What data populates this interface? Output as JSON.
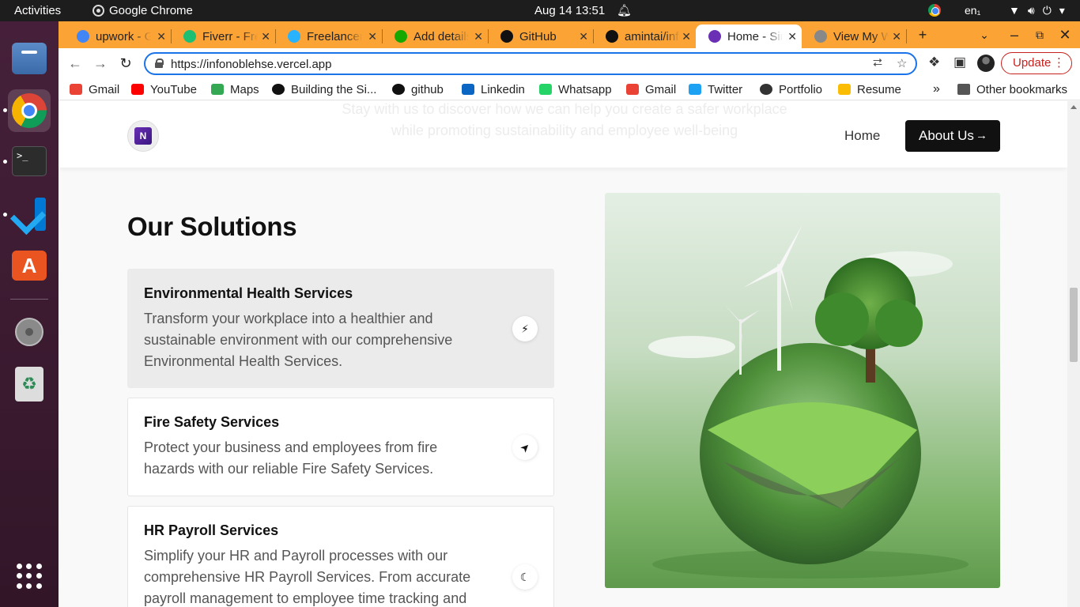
{
  "os": {
    "activities": "Activities",
    "app_name": "Google Chrome",
    "clock": "Aug 14  13:51",
    "language": "en₁",
    "dock": [
      "files-icon",
      "chrome-icon",
      "terminal-icon",
      "vscode-icon",
      "app-store-icon",
      "disc-icon",
      "trash-icon",
      "app-grid-icon"
    ]
  },
  "browser": {
    "tabs": [
      {
        "label": "upwork - Google",
        "icon": "google-icon",
        "color": "#4285f4"
      },
      {
        "label": "Fiverr - Freelance",
        "icon": "fiverr-icon",
        "color": "#1dbf73"
      },
      {
        "label": "Freelancer",
        "icon": "freelancer-icon",
        "color": "#29b2fe"
      },
      {
        "label": "Add details",
        "icon": "upwork-icon",
        "color": "#14a800"
      },
      {
        "label": "GitHub",
        "icon": "github-icon",
        "color": "#111111"
      },
      {
        "label": "amintai/infonoble",
        "icon": "github-icon",
        "color": "#111111"
      },
      {
        "label": "Home - Simple",
        "icon": "site-favicon",
        "color": "#6a2fb5",
        "active": true
      },
      {
        "label": "View My Work",
        "icon": "globe-icon",
        "color": "#888888"
      }
    ],
    "address": "https://infonoblehse.vercel.app",
    "update_label": "Update",
    "bookmarks": [
      {
        "label": "Gmail",
        "icon": "gmail-icon"
      },
      {
        "label": "YouTube",
        "icon": "youtube-icon"
      },
      {
        "label": "Maps",
        "icon": "maps-icon"
      },
      {
        "label": "Building the Si...",
        "icon": "vercel-icon"
      },
      {
        "label": "github",
        "icon": "github-icon"
      },
      {
        "label": "Linkedin",
        "icon": "linkedin-icon"
      },
      {
        "label": "Whatsapp",
        "icon": "whatsapp-icon"
      },
      {
        "label": "Gmail",
        "icon": "gmail-icon"
      },
      {
        "label": "Twitter",
        "icon": "twitter-icon"
      },
      {
        "label": "Portfolio",
        "icon": "globe-icon"
      },
      {
        "label": "Resume",
        "icon": "drive-icon"
      }
    ],
    "more_bookmarks": "»",
    "other_bookmarks": "Other bookmarks"
  },
  "site": {
    "ghost_line_1": "Stay with us to discover how we can help you create a safer workplace",
    "ghost_line_2": "while promoting sustainability and employee well-being",
    "nav_home": "Home",
    "nav_about": "About Us",
    "section_title": "Our Solutions",
    "solutions": [
      {
        "title": "Environmental Health Services",
        "text": "Transform your workplace into a healthier and sustainable environment with our comprehensive Environmental Health Services.",
        "icon": "lightning-icon",
        "glyph": "⚡",
        "active": true
      },
      {
        "title": "Fire Safety Services",
        "text": "Protect your business and employees from fire hazards with our reliable Fire Safety Services.",
        "icon": "navigation-arrow-icon",
        "glyph": "➤"
      },
      {
        "title": "HR Payroll Services",
        "text": "Simplify your HR and Payroll processes with our comprehensive HR Payroll Services. From accurate payroll management to employee time tracking and",
        "icon": "moon-icon",
        "glyph": "☾"
      }
    ],
    "hero_image": "green-earth-wind-turbine-tree-image"
  },
  "colors": {
    "tab_strip": "#fca335",
    "dock": "#3a1a2e",
    "accent_button": "#111111",
    "update_red": "#c5221f",
    "omnibox_focus": "#1a73e8"
  }
}
